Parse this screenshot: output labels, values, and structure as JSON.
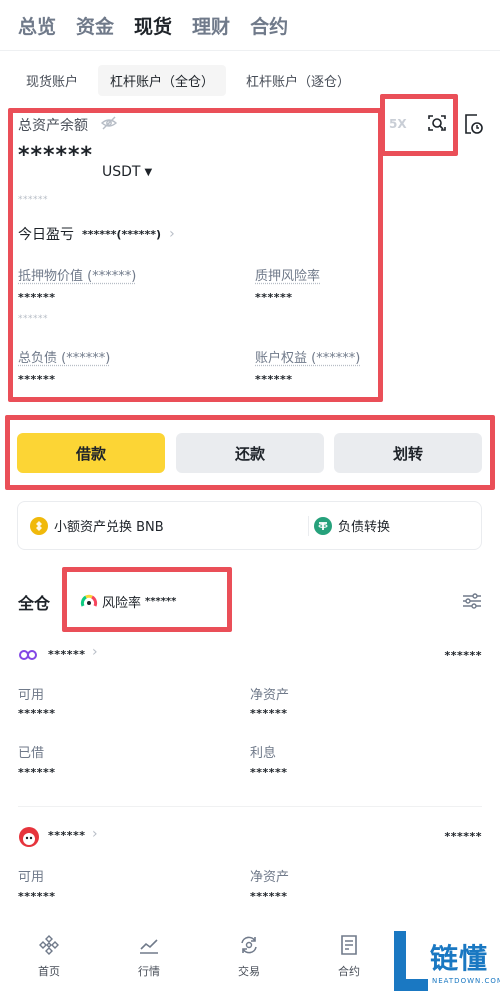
{
  "top_tabs": [
    "总览",
    "资金",
    "现货",
    "理财",
    "合约"
  ],
  "sub_tabs": [
    "现货账户",
    "杠杆账户（全仓）",
    "杠杆账户（逐仓）"
  ],
  "asset": {
    "total_label": "总资产余额",
    "leverage": "5X",
    "total_value": "******",
    "currency": "USDT",
    "sub_value": "******",
    "pnl_label": "今日盈亏",
    "pnl_value": "******(******)",
    "collateral_label": "抵押物价值 (******)",
    "collateral_value": "******",
    "collateral_sub": "******",
    "risk_label": "质押风险率",
    "risk_value": "******",
    "debt_label": "总负债 (******)",
    "debt_value": "******",
    "equity_label": "账户权益 (******)",
    "equity_value": "******"
  },
  "actions": {
    "borrow": "借款",
    "repay": "还款",
    "transfer": "划转"
  },
  "convert": {
    "small_assets": "小额资产兑换 BNB",
    "debt_transfer": "负债转换"
  },
  "cross": {
    "title": "全仓",
    "risk_label": "风险率",
    "risk_value": "******"
  },
  "coins": [
    {
      "name": "******",
      "total": "******",
      "available_label": "可用",
      "available": "******",
      "net_label": "净资产",
      "net": "******",
      "borrowed_label": "已借",
      "borrowed": "******",
      "interest_label": "利息",
      "interest": "******"
    },
    {
      "name": "******",
      "total": "******",
      "available_label": "可用",
      "available": "******",
      "net_label": "净资产",
      "net": "******"
    }
  ],
  "nav": [
    "首页",
    "行情",
    "交易",
    "合约"
  ],
  "watermark": {
    "cn": "链懂",
    "en": "NEATDOWN.COM"
  },
  "colors": {
    "accent": "#fcd535",
    "highlight": "#ea4f58",
    "watermark": "#1a78c2"
  }
}
